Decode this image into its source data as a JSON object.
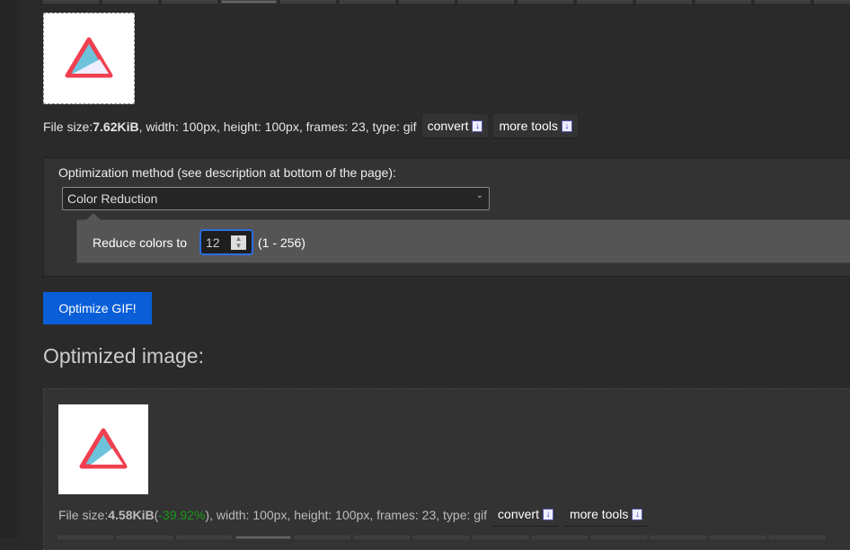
{
  "original": {
    "file_size_label": "File size: ",
    "file_size": "7.62KiB",
    "details": ", width: 100px, height: 100px, frames: 23, type: gif",
    "convert": "convert",
    "more_tools": "more tools"
  },
  "form": {
    "method_label": "Optimization method (see description at bottom of the page):",
    "method_value": "Color Reduction",
    "reduce_label": "Reduce colors to",
    "colors_value": "12",
    "range": "(1 - 256)"
  },
  "optimize_button": "Optimize GIF!",
  "result": {
    "heading": "Optimized image:",
    "file_size_label": "File size: ",
    "file_size": "4.58KiB",
    "open_paren": " (",
    "change": "-39.92%",
    "details": "), width: 100px, height: 100px, frames: 23, type: gif",
    "convert": "convert",
    "more_tools": "more tools"
  },
  "colors": {
    "accent": "#0a5fd8",
    "savings": "#1a9a1a",
    "focus": "#2a6fe0"
  }
}
